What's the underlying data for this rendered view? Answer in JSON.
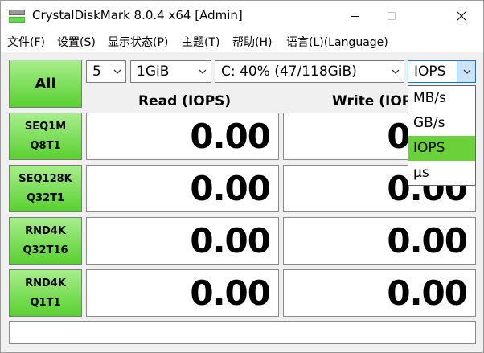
{
  "window": {
    "title": "CrystalDiskMark 8.0.4 x64 [Admin]"
  },
  "menu": [
    {
      "label": "文件(F)"
    },
    {
      "label": "设置(S)"
    },
    {
      "label": "显示状态(P)"
    },
    {
      "label": "主题(T)"
    },
    {
      "label": "帮助(H)"
    },
    {
      "label": "语言(L)(Language)"
    }
  ],
  "controls": {
    "all_button": "All",
    "count": "5",
    "size": "1GiB",
    "drive": "C: 40% (47/118GiB)",
    "unit": "IOPS"
  },
  "headers": {
    "read": "Read (IOPS)",
    "write": "Write (IOPS)"
  },
  "tests": [
    {
      "line1": "SEQ1M",
      "line2": "Q8T1",
      "read": "0.00",
      "write": "0.00"
    },
    {
      "line1": "SEQ128K",
      "line2": "Q32T1",
      "read": "0.00",
      "write": "0.00"
    },
    {
      "line1": "RND4K",
      "line2": "Q32T16",
      "read": "0.00",
      "write": "0.00"
    },
    {
      "line1": "RND4K",
      "line2": "Q1T1",
      "read": "0.00",
      "write": "0.00"
    }
  ],
  "unit_dropdown": {
    "options": [
      "MB/s",
      "GB/s",
      "IOPS",
      "μs"
    ],
    "selected": "IOPS"
  },
  "status": "",
  "colors": {
    "button_green_top": "#a8ee8c",
    "button_green_bottom": "#59d030",
    "selected_option": "#6ad13a",
    "focus_blue": "#0078d7"
  }
}
